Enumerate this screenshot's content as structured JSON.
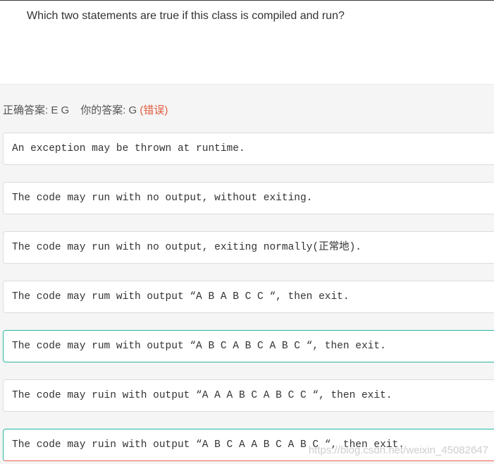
{
  "question": {
    "text": "Which two statements are true if this class is compiled and run?"
  },
  "summary": {
    "correct_label": "正确答案: E G",
    "yours_label": "你的答案: G",
    "status": "(错误)"
  },
  "options": [
    {
      "text": "An exception may be thrown at runtime.",
      "state": "normal"
    },
    {
      "text": "The code may run with no output, without exiting.",
      "state": "normal"
    },
    {
      "text": "The code may run with no output, exiting normally(正常地).",
      "state": "normal"
    },
    {
      "text": "The code may rum with output “A B A B C C “, then exit.",
      "state": "normal"
    },
    {
      "text": "The code may rum with output “A B C A B C A B C “, then exit.",
      "state": "correct"
    },
    {
      "text": "The code may ruin with output “A A A B C A B C C “, then exit.",
      "state": "normal"
    },
    {
      "text": "The code may ruin with output “A B C A A B C A B C “, then exit.",
      "state": "selected-correct"
    }
  ],
  "watermark": "https://blog.csdn.net/weixin_45082647",
  "colors": {
    "correct_border": "#2ab5a0",
    "wrong_border": "#ee5f4f",
    "wrong_text": "#e05a3c"
  }
}
